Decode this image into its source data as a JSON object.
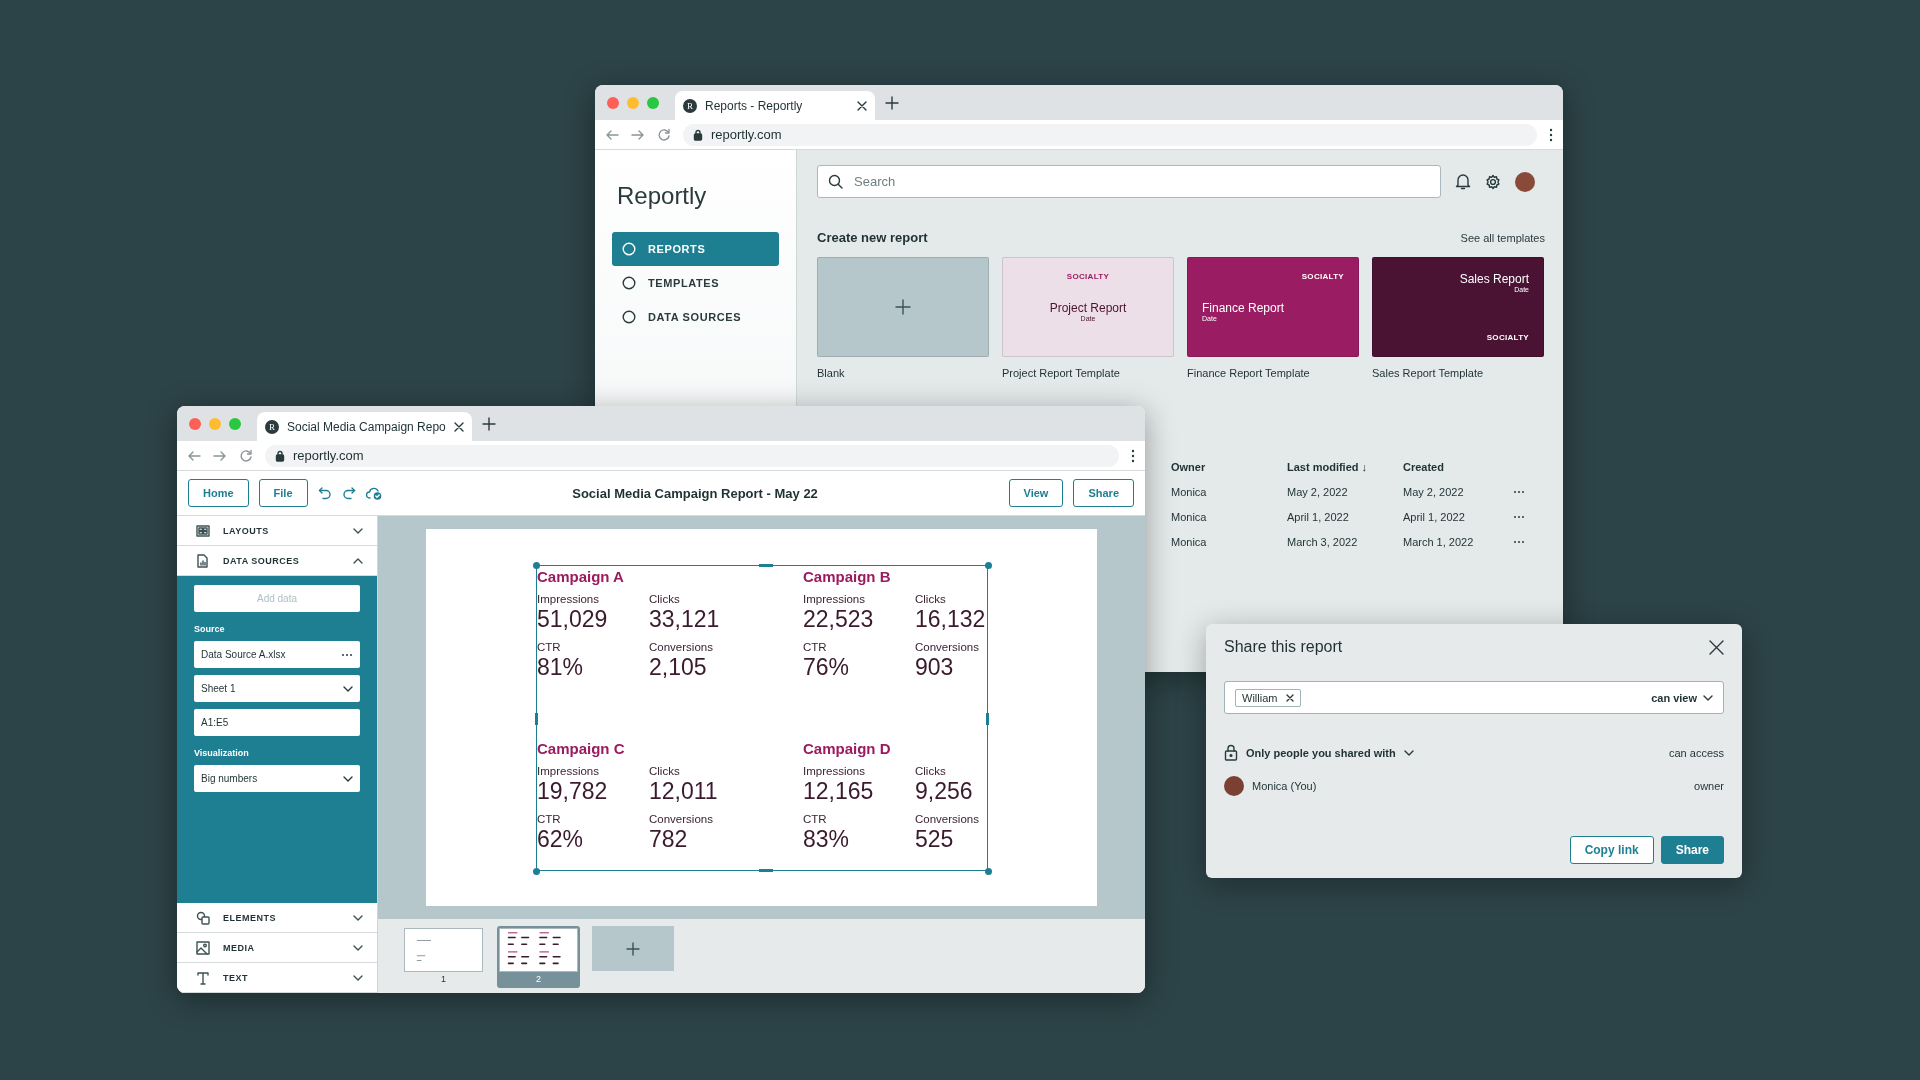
{
  "back_window": {
    "tab": {
      "favicon": "R",
      "title": "Reports - Reportly"
    },
    "url": "reportly.com",
    "logo": "Reportly",
    "nav": [
      {
        "label": "REPORTS",
        "selected": true
      },
      {
        "label": "TEMPLATES",
        "selected": false
      },
      {
        "label": "DATA SOURCES",
        "selected": false
      }
    ],
    "search": {
      "placeholder": "Search"
    },
    "create_heading": "Create new report",
    "see_all_link": "See all templates",
    "templates": [
      {
        "kind": "blank",
        "color": "#b5c7cb",
        "label": "Blank"
      },
      {
        "kind": "centered",
        "color": "#eddfe7",
        "brand": "SOCIALTY",
        "title": "Project Report",
        "date": "Date",
        "label": "Project Report Template"
      },
      {
        "kind": "left",
        "color": "#9a1d63",
        "brand": "SOCIALTY",
        "title": "Finance Report",
        "date": "Date",
        "label": "Finance Report Template"
      },
      {
        "kind": "stacked",
        "color": "#4a1333",
        "brand": "SOCIALTY",
        "title": "Sales Report",
        "date": "Date",
        "label": "Sales Report Template"
      }
    ],
    "table": {
      "columns": [
        {
          "label": "Owner"
        },
        {
          "label": "Last modified",
          "sort": "↓"
        },
        {
          "label": "Created"
        }
      ],
      "rows": [
        {
          "owner": "Monica",
          "modified": "May 2, 2022",
          "created": "May 2, 2022"
        },
        {
          "owner": "Monica",
          "modified": "April 1, 2022",
          "created": "April 1, 2022"
        },
        {
          "owner": "Monica",
          "modified": "March 3, 2022",
          "created": "March 1, 2022"
        }
      ]
    }
  },
  "front_window": {
    "tab": {
      "favicon": "R",
      "title": "Social Media Campaign Repo"
    },
    "url": "reportly.com",
    "toolbar": {
      "buttons": [
        "Home",
        "File"
      ],
      "document_title": "Social Media Campaign Report - May 22",
      "actions": [
        "View",
        "Share"
      ]
    },
    "sidebar": {
      "sections": [
        {
          "label": "LAYOUTS",
          "expanded": false
        },
        {
          "label": "DATA SOURCES",
          "expanded": true
        },
        {
          "label": "ELEMENTS",
          "expanded": false
        },
        {
          "label": "MEDIA",
          "expanded": false
        },
        {
          "label": "TEXT",
          "expanded": false
        }
      ],
      "data_panel": {
        "add_button": {
          "label": "Add data",
          "disabled": true
        },
        "source_label": "Source",
        "source_file": "Data Source A.xlsx",
        "sheet": "Sheet 1",
        "range": "A1:E5",
        "visualization_label": "Visualization",
        "visualization": "Big numbers"
      }
    },
    "slide": {
      "selected": true,
      "campaigns": [
        {
          "name": "Campaign A",
          "metrics": [
            {
              "label": "Impressions",
              "value": "51,029"
            },
            {
              "label": "Clicks",
              "value": "33,121"
            },
            {
              "label": "CTR",
              "value": "81%"
            },
            {
              "label": "Conversions",
              "value": "2,105"
            }
          ]
        },
        {
          "name": "Campaign B",
          "metrics": [
            {
              "label": "Impressions",
              "value": "22,523"
            },
            {
              "label": "Clicks",
              "value": "16,132"
            },
            {
              "label": "CTR",
              "value": "76%"
            },
            {
              "label": "Conversions",
              "value": "903"
            }
          ]
        },
        {
          "name": "Campaign C",
          "metrics": [
            {
              "label": "Impressions",
              "value": "19,782"
            },
            {
              "label": "Clicks",
              "value": "12,011"
            },
            {
              "label": "CTR",
              "value": "62%"
            },
            {
              "label": "Conversions",
              "value": "782"
            }
          ]
        },
        {
          "name": "Campaign D",
          "metrics": [
            {
              "label": "Impressions",
              "value": "12,165"
            },
            {
              "label": "Clicks",
              "value": "9,256"
            },
            {
              "label": "CTR",
              "value": "83%"
            },
            {
              "label": "Conversions",
              "value": "525"
            }
          ]
        }
      ]
    },
    "thumbnails": [
      {
        "number": "1",
        "selected": false
      },
      {
        "number": "2",
        "selected": true
      }
    ]
  },
  "share_dialog": {
    "title": "Share this report",
    "recipient": "William",
    "permission": "can view",
    "access": "Only people you shared with",
    "access_level": "can access",
    "people": [
      {
        "name": "Monica (You)",
        "role": "owner"
      }
    ],
    "buttons": [
      {
        "label": "Copy link",
        "kind": "secondary"
      },
      {
        "label": "Share",
        "kind": "primary"
      }
    ]
  }
}
